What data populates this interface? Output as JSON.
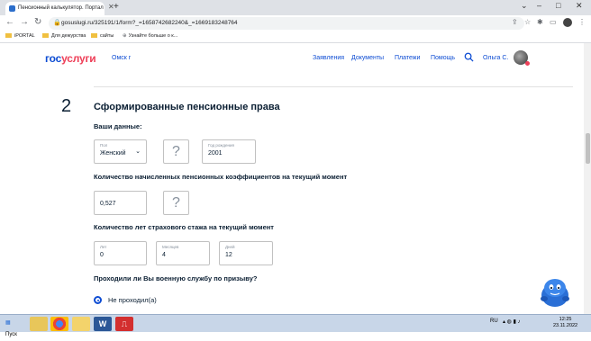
{
  "browser": {
    "tab_title": "Пенсионный калькулятор. Портал",
    "url": "gosuslugi.ru/325191/1/form?_=1658742682240&_=1669183248764",
    "bookmarks": [
      "iPORTAL",
      "Для дежурства",
      "сайты",
      "Узнайте больше о к..."
    ]
  },
  "header": {
    "logo_part1": "гос",
    "logo_part2": "услуги",
    "city": "Омск г",
    "menu": [
      "Заявления",
      "Документы",
      "Платежи",
      "Помощь"
    ],
    "user": "Ольга С."
  },
  "form": {
    "step_number": "2",
    "step_title": "Сформированные пенсионные права",
    "your_data_label": "Ваши данные:",
    "gender": {
      "caption": "Пол",
      "value": "Женский"
    },
    "birth_year": {
      "caption": "Год рождения",
      "value": "2001"
    },
    "coef_label": "Количество начисленных пенсионных коэффициентов на текущий момент",
    "coef_value": "0,527",
    "experience_label": "Количество лет страхового стажа на текущий момент",
    "years": {
      "caption": "Лет",
      "value": "0"
    },
    "months": {
      "caption": "Месяцев",
      "value": "4"
    },
    "days": {
      "caption": "Дней",
      "value": "12"
    },
    "military_label": "Проходили ли Вы военную службу по призыву?",
    "military_option": "Не проходил(а)",
    "help_mark": "?"
  },
  "taskbar": {
    "start": "Пуск",
    "lang": "RU",
    "time": "12:25",
    "date": "23.11.2022"
  },
  "colors": {
    "brand_blue": "#0d4cd3",
    "brand_red": "#ee3f58"
  }
}
